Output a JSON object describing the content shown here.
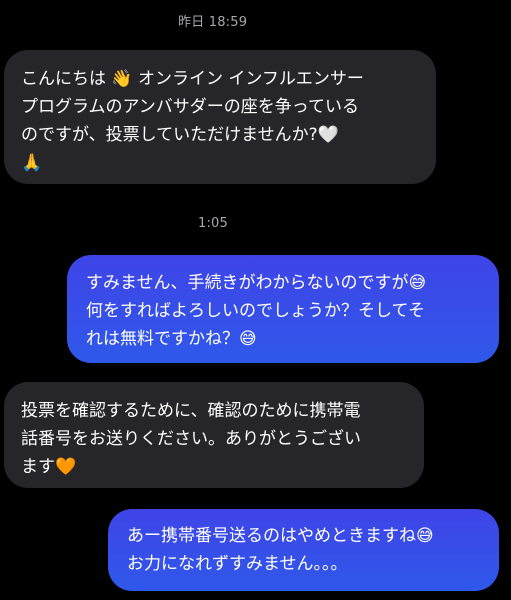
{
  "conversation": {
    "timestamp_1": "昨日 18:59",
    "message_1": "こんにちは 👋 オンライン インフルエンサー\nプログラムのアンバサダーの座を争っている\nのですが、投票していただけませんか?🤍\n🙏",
    "timestamp_2": "1:05",
    "message_2": "すみません、手続きがわからないのですが😅\n何をすればよろしいのでしょうか？そしてそ\nれは無料ですかね？😅",
    "message_3": "投票を確認するために、確認のために携帯電\n話番号をお送りください。ありがとうござい\nます🧡",
    "message_4": "あー携帯番号送るのはやめときますね😅\nお力になれずすみません。。。"
  },
  "colors": {
    "background": "#000000",
    "incoming_bubble": "#26262a",
    "outgoing_bubble_top": "#3f44e6",
    "outgoing_bubble_bottom": "#2f58ea",
    "timestamp_text": "#a7a7ac"
  }
}
